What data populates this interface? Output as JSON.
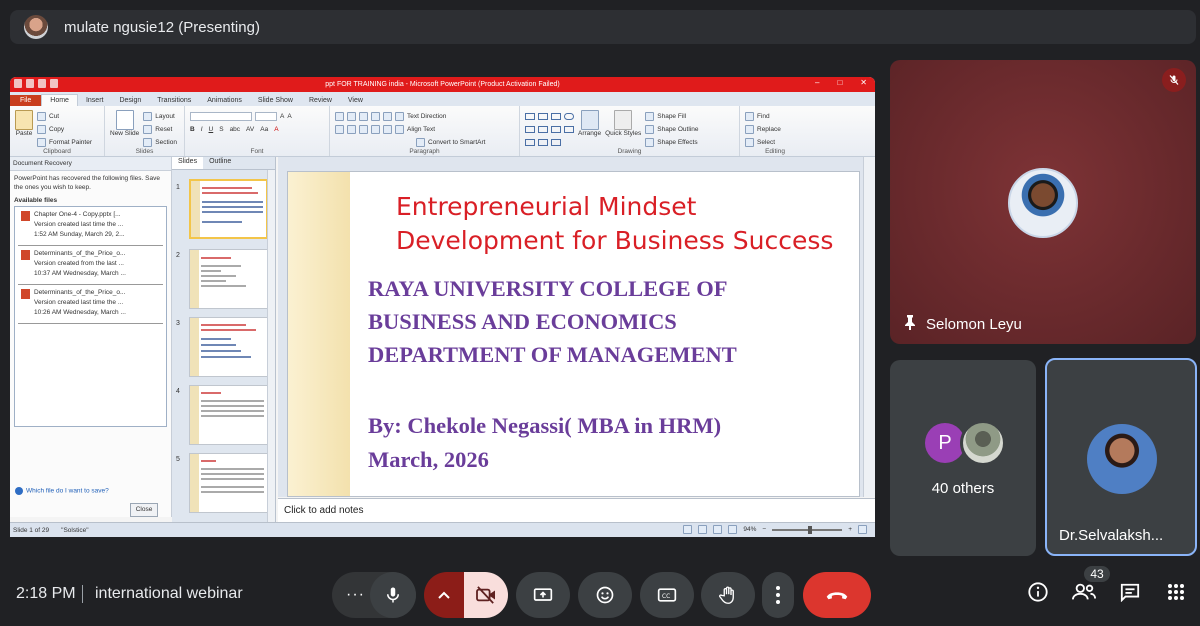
{
  "header": {
    "presenter_label": "mulate ngusie12 (Presenting)"
  },
  "ppt": {
    "window_title": "ppt FOR TRAINING india  -  Microsoft PowerPoint (Product Activation Failed)",
    "tabs": [
      "File",
      "Home",
      "Insert",
      "Design",
      "Transitions",
      "Animations",
      "Slide Show",
      "Review",
      "View"
    ],
    "ribbon": {
      "clipboard": {
        "paste": "Paste",
        "cut": "Cut",
        "copy": "Copy",
        "format_painter": "Format Painter",
        "group": "Clipboard"
      },
      "slides": {
        "new_slide": "New Slide",
        "layout": "Layout",
        "reset": "Reset",
        "section": "Section",
        "group": "Slides"
      },
      "font": {
        "group": "Font"
      },
      "paragraph": {
        "text_direction": "Text Direction",
        "align_text": "Align Text",
        "convert": "Convert to SmartArt",
        "group": "Paragraph"
      },
      "drawing": {
        "arrange": "Arrange",
        "quick_styles": "Quick Styles",
        "shape_fill": "Shape Fill",
        "shape_outline": "Shape Outline",
        "shape_effects": "Shape Effects",
        "group": "Drawing"
      },
      "editing": {
        "find": "Find",
        "replace": "Replace",
        "select": "Select",
        "group": "Editing"
      }
    },
    "recovery": {
      "title": "Document Recovery",
      "description": "PowerPoint has recovered the following files. Save the ones you wish to keep.",
      "available": "Available files",
      "files": [
        {
          "name": "Chapter One-4 - Copy.pptx  [...",
          "line2": "Version created last time the ...",
          "line3": "1:52 AM Sunday, March 29, 2..."
        },
        {
          "name": "Determinants_of_the_Price_o...",
          "line2": "Version created from the last ...",
          "line3": "10:37 AM Wednesday, March ..."
        },
        {
          "name": "Determinants_of_the_Price_o...",
          "line2": "Version created last time the ...",
          "line3": "10:26 AM Wednesday, March ..."
        }
      ],
      "help_link": "Which file do I want to save?",
      "close": "Close"
    },
    "thumb_tabs": [
      "Slides",
      "Outline"
    ],
    "thumb_numbers": [
      "1",
      "2",
      "3",
      "4",
      "5"
    ],
    "slide": {
      "title_line1": "Entrepreneurial Mindset",
      "title_line2": "Development for Business Success",
      "body_line1": "RAYA UNIVERSITY COLLEGE OF",
      "body_line2": "BUSINESS AND ECONOMICS",
      "body_line3": "DEPARTMENT OF MANAGEMENT",
      "by_line": "By: Chekole Negassi( MBA in HRM)",
      "date_line": "March, 2026"
    },
    "notes_placeholder": "Click to add notes",
    "status": {
      "slide_count": "Slide 1 of 29",
      "theme": "\"Solstice\"",
      "zoom": "94%"
    }
  },
  "participants": {
    "main": {
      "name": "Selomon Leyu"
    },
    "others": {
      "initial": "P",
      "label": "40 others"
    },
    "third": {
      "name": "Dr.Selvalaksh..."
    }
  },
  "bottom": {
    "time": "2:18 PM",
    "meeting": "international webinar",
    "people_count": "43"
  },
  "colors": {
    "end_call": "#dc362e",
    "slide_title": "#d91f26",
    "slide_body": "#6a3d9a",
    "ppt_title_bar": "#e01b1b"
  }
}
